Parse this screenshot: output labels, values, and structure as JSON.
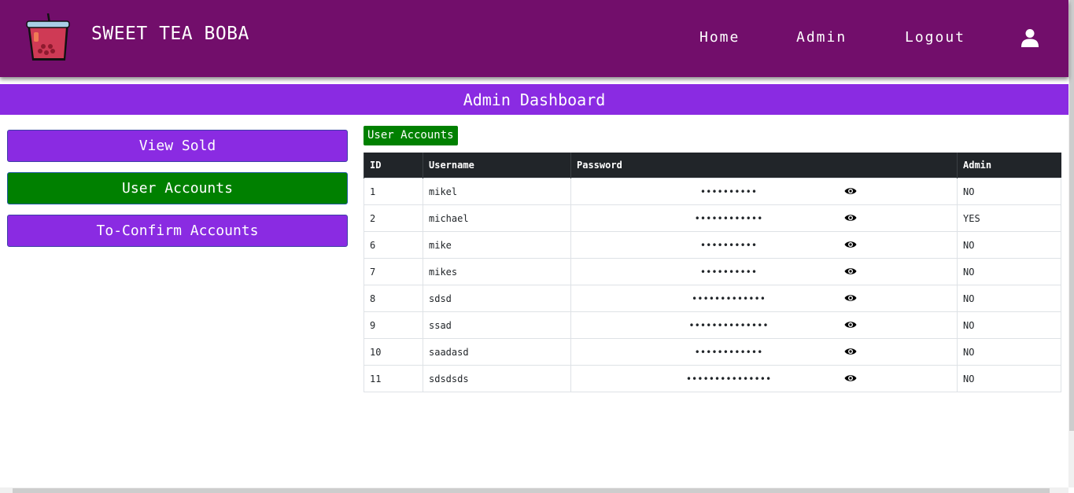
{
  "brand": {
    "name": "SWEET TEA BOBA",
    "logo_icon": "boba-cup-icon"
  },
  "nav": {
    "home": "Home",
    "admin": "Admin",
    "logout": "Logout",
    "user_icon": "user-icon"
  },
  "banner": {
    "title": "Admin Dashboard"
  },
  "sidebar": {
    "view_sold": "View Sold",
    "user_accounts": "User Accounts",
    "to_confirm": "To-Confirm Accounts"
  },
  "section": {
    "label": "User Accounts"
  },
  "table": {
    "headers": {
      "id": "ID",
      "username": "Username",
      "password": "Password",
      "admin": "Admin"
    },
    "rows": [
      {
        "id": "1",
        "username": "mikel",
        "password": "••••••••••",
        "admin": "NO"
      },
      {
        "id": "2",
        "username": "michael",
        "password": "••••••••••••",
        "admin": "YES"
      },
      {
        "id": "6",
        "username": "mike",
        "password": "••••••••••",
        "admin": "NO"
      },
      {
        "id": "7",
        "username": "mikes",
        "password": "••••••••••",
        "admin": "NO"
      },
      {
        "id": "8",
        "username": "sdsd",
        "password": "•••••••••••••",
        "admin": "NO"
      },
      {
        "id": "9",
        "username": "ssad",
        "password": "••••••••••••••",
        "admin": "NO"
      },
      {
        "id": "10",
        "username": "saadasd",
        "password": "••••••••••••",
        "admin": "NO"
      },
      {
        "id": "11",
        "username": "sdsdsds",
        "password": "•••••••••••••••",
        "admin": "NO"
      }
    ]
  },
  "colors": {
    "navbar": "#720e6b",
    "accent_purple": "#8a2be2",
    "active_green": "#008000",
    "table_header": "#212529"
  }
}
